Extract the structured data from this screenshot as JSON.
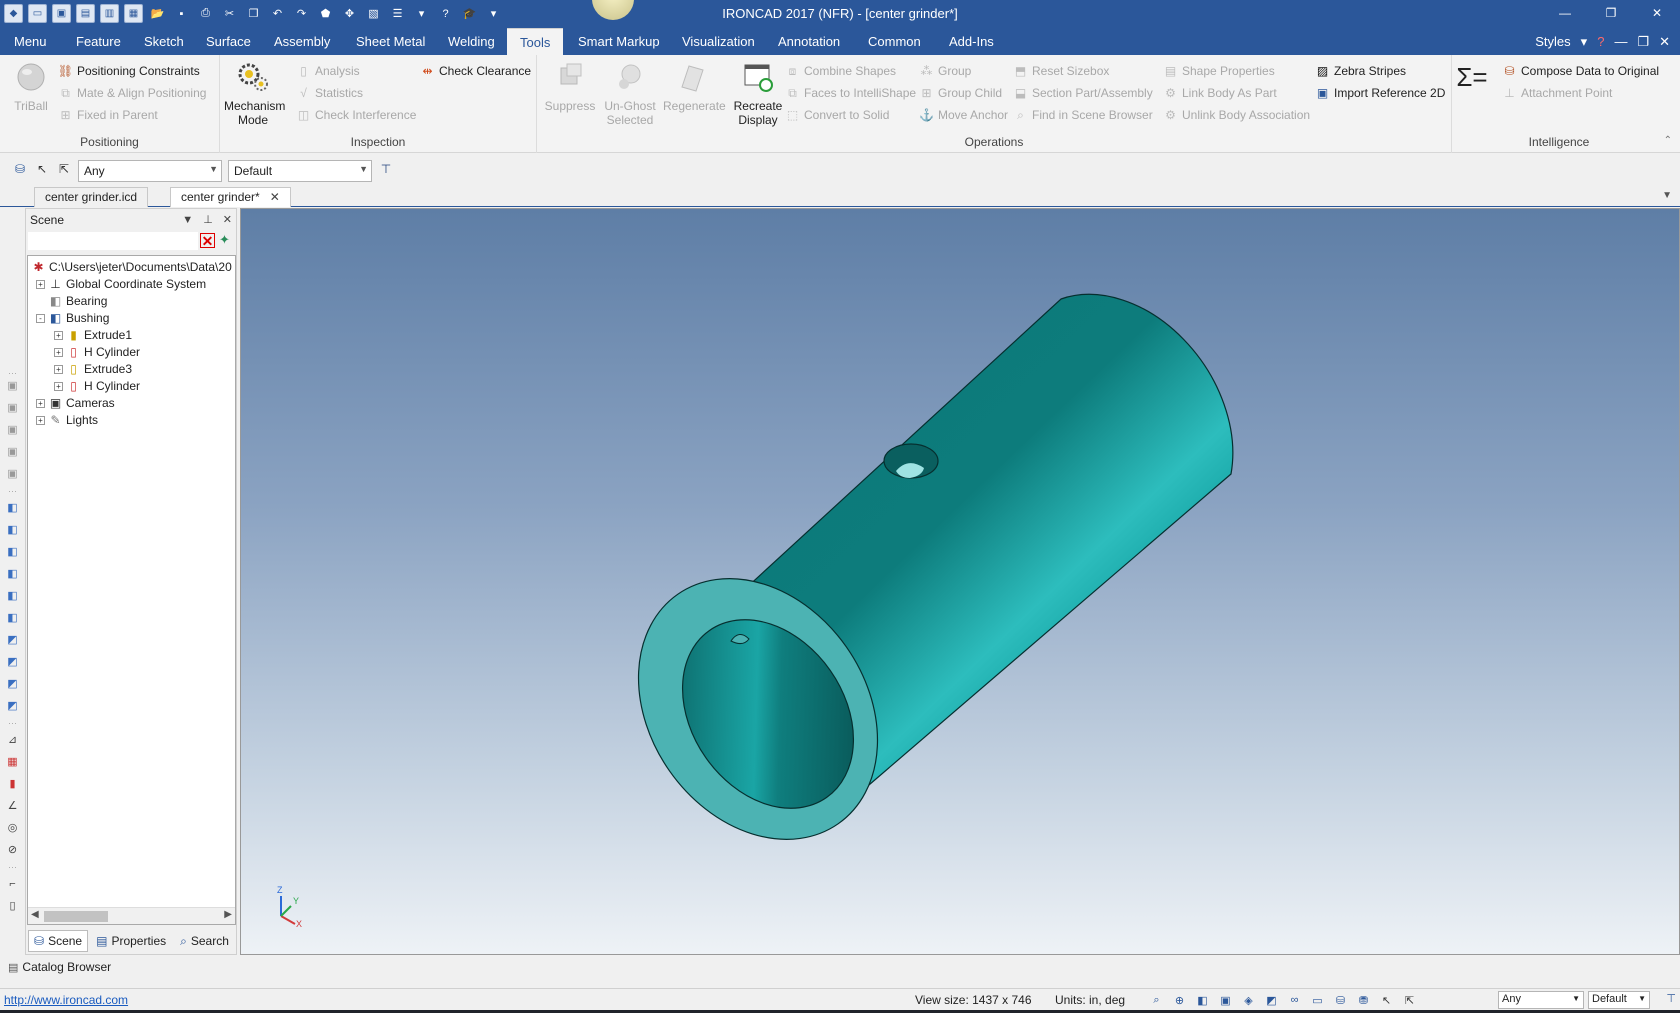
{
  "window": {
    "title": "IRONCAD 2017 (NFR) - [center grinder*]",
    "controls": [
      "minimize",
      "restore",
      "close"
    ]
  },
  "menu": {
    "tabs": [
      "Menu",
      "Feature",
      "Sketch",
      "Surface",
      "Assembly",
      "Sheet Metal",
      "Welding",
      "Tools",
      "Smart Markup",
      "Visualization",
      "Annotation",
      "Common",
      "Add-Ins"
    ],
    "active_tab": "Tools",
    "styles_label": "Styles"
  },
  "ribbon": {
    "positioning": {
      "label": "Positioning",
      "triball": "TriBall",
      "positioning_constraints": "Positioning Constraints",
      "mate_align": "Mate & Align Positioning",
      "fixed_in_parent": "Fixed in Parent"
    },
    "inspection": {
      "label": "Inspection",
      "mechanism_mode_1": "Mechanism",
      "mechanism_mode_2": "Mode",
      "analysis": "Analysis",
      "statistics": "Statistics",
      "check_interference": "Check Interference",
      "check_clearance": "Check Clearance"
    },
    "operations": {
      "label": "Operations",
      "suppress": "Suppress",
      "unghost_1": "Un-Ghost",
      "unghost_2": "Selected",
      "regenerate": "Regenerate",
      "recreate_1": "Recreate",
      "recreate_2": "Display",
      "combine_shapes": "Combine Shapes",
      "faces_to_intellishape": "Faces to IntelliShape",
      "convert_to_solid": "Convert to Solid",
      "group": "Group",
      "group_child": "Group Child",
      "move_anchor": "Move Anchor",
      "reset_sizebox": "Reset Sizebox",
      "section_part": "Section Part/Assembly",
      "find_in_scene": "Find in Scene Browser",
      "shape_properties": "Shape Properties",
      "link_body": "Link Body As Part",
      "unlink_body": "Unlink Body Association",
      "zebra_stripes": "Zebra Stripes",
      "import_reference_2d": "Import Reference 2D"
    },
    "intelligence": {
      "label": "Intelligence",
      "compose_data": "Compose Data to Original",
      "attachment_point": "Attachment Point"
    }
  },
  "selection_toolbar": {
    "filter_value": "Any",
    "style_value": "Default"
  },
  "doc_tabs": [
    {
      "label": "center grinder.icd",
      "active": false
    },
    {
      "label": "center grinder*",
      "active": true
    }
  ],
  "scene": {
    "title": "Scene",
    "tree": [
      {
        "label": "C:\\Users\\jeter\\Documents\\Data\\20",
        "icon": "scene-root-icon",
        "level": 0,
        "expander": ""
      },
      {
        "label": "Global Coordinate System",
        "icon": "coordinate-system-icon",
        "level": 1,
        "expander": "+"
      },
      {
        "label": "Bearing",
        "icon": "part-icon",
        "level": 1,
        "expander": ""
      },
      {
        "label": "Bushing",
        "icon": "part-icon",
        "level": 1,
        "expander": "-"
      },
      {
        "label": "Extrude1",
        "icon": "extrude-icon",
        "level": 2,
        "expander": "+"
      },
      {
        "label": "H Cylinder",
        "icon": "cylinder-icon",
        "level": 2,
        "expander": "+"
      },
      {
        "label": "Extrude3",
        "icon": "extrude-icon",
        "level": 2,
        "expander": "+"
      },
      {
        "label": "H Cylinder",
        "icon": "cylinder-icon",
        "level": 2,
        "expander": "+"
      },
      {
        "label": "Cameras",
        "icon": "camera-icon",
        "level": 1,
        "expander": "+"
      },
      {
        "label": "Lights",
        "icon": "light-icon",
        "level": 1,
        "expander": "+"
      }
    ],
    "bottom_tabs": [
      "Scene",
      "Properties",
      "Search"
    ]
  },
  "viewport": {
    "triad_labels": {
      "z": "Z",
      "y": "Y",
      "x": "X"
    },
    "part_color": "#0b6e6e"
  },
  "catalog": {
    "label": "Catalog Browser"
  },
  "statusbar": {
    "url": "http://www.ironcad.com",
    "view_size": "View size: 1437 x  746",
    "units": "Units: in, deg",
    "filter_value": "Any",
    "style_value": "Default"
  }
}
